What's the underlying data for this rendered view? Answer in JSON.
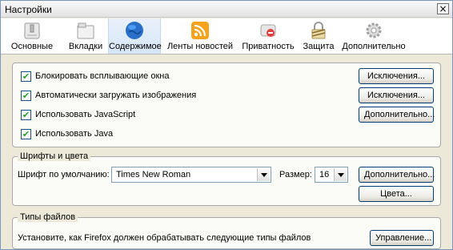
{
  "window": {
    "title": "Настройки",
    "close_glyph": "×"
  },
  "tabs": [
    {
      "label": "Основные",
      "icon": "switch-icon",
      "selected": false
    },
    {
      "label": "Вкладки",
      "icon": "tabs-icon",
      "selected": false
    },
    {
      "label": "Содержимое",
      "icon": "globe-icon",
      "selected": true
    },
    {
      "label": "Ленты новостей",
      "icon": "rss-icon",
      "selected": false
    },
    {
      "label": "Приватность",
      "icon": "mask-icon",
      "selected": false
    },
    {
      "label": "Защита",
      "icon": "padlock-icon",
      "selected": false
    },
    {
      "label": "Дополнительно",
      "icon": "gear-icon",
      "selected": false
    }
  ],
  "content_options": {
    "block_popups": {
      "label": "Блокировать всплывающие окна",
      "checked": true
    },
    "load_images": {
      "label": "Автоматически загружать изображения",
      "checked": true
    },
    "enable_js": {
      "label": "Использовать JavaScript",
      "checked": true
    },
    "enable_java": {
      "label": "Использовать Java",
      "checked": true
    },
    "exceptions_label": "Исключения...",
    "exceptions2_label": "Исключения...",
    "js_advanced_label": "Дополнительно..."
  },
  "fonts": {
    "legend": "Шрифты и цвета",
    "default_font_label": "Шрифт по умолчанию:",
    "default_font_value": "Times New Roman",
    "size_label": "Размер:",
    "size_value": "16",
    "advanced_label": "Дополнительно...",
    "colors_label": "Цвета..."
  },
  "file_types": {
    "legend": "Типы файлов",
    "description": "Установите, как Firefox должен обрабатывать следующие типы файлов",
    "manage_label": "Управление..."
  },
  "colors": {
    "check_mark": "#21a121",
    "selected_tab": "#d7e6f7",
    "button_border": "#003c74"
  }
}
